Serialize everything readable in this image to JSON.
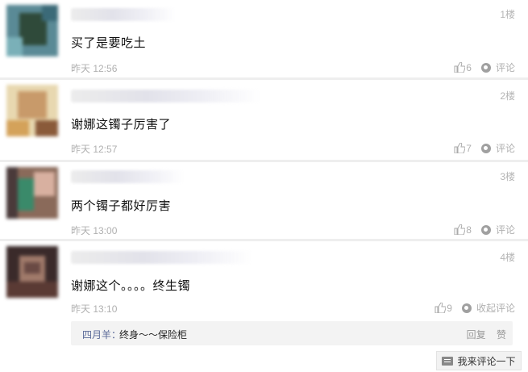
{
  "comments": [
    {
      "floor": "1楼",
      "text": "买了是要吃土",
      "time": "昨天 12:56",
      "likes": "6",
      "comment_label": "评论"
    },
    {
      "floor": "2楼",
      "text": "谢娜这镯子厉害了",
      "time": "昨天 12:57",
      "likes": "7",
      "comment_label": "评论"
    },
    {
      "floor": "3楼",
      "text": "两个镯子都好厉害",
      "time": "昨天 13:00",
      "likes": "8",
      "comment_label": "评论"
    },
    {
      "floor": "4楼",
      "text": "谢娜这个。。。。终生镯",
      "time": "昨天 13:10",
      "likes": "9",
      "comment_label": "收起评论"
    }
  ],
  "reply": {
    "user": "四月羊：",
    "text": "终身～～保险柜",
    "reply_label": "回复",
    "like_label": "赞"
  },
  "footer": {
    "write_label": "我来评论一下"
  },
  "colors": {
    "divider": "#eeeeee",
    "meta": "#b0b0b0",
    "reply_user": "#5b6a98"
  }
}
